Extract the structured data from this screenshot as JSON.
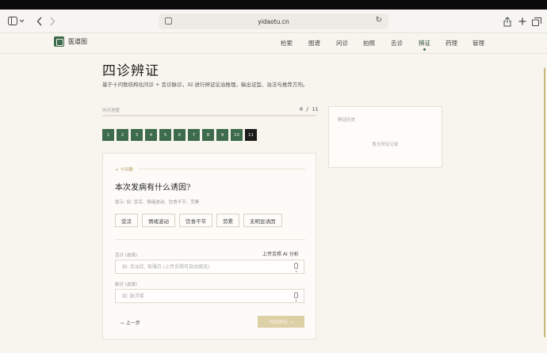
{
  "browser": {
    "url": "yidaotu.cn",
    "icons": {
      "sidebar": "sidebar-icon",
      "back": "chevron-left-icon",
      "forward": "chevron-right-icon",
      "share": "share-icon",
      "new_tab": "plus-icon",
      "tabs": "tabs-icon",
      "reload": "reload-icon"
    }
  },
  "site": {
    "logo_text": "医道图",
    "nav": [
      "检索",
      "图谱",
      "问诊",
      "拍照",
      "舌诊",
      "辨证",
      "药理",
      "管理"
    ],
    "active_nav": "辨证",
    "colors": {
      "brand": "#3d6b4b",
      "accent": "#b39a56"
    }
  },
  "page": {
    "title": "四诊辨证",
    "description": "基于十问歌结构化问诊 + 舌诊脉诊，AI 进行辨证论治推理，输出证型、治法与推荐方剂。"
  },
  "progress": {
    "label": "问诊进度",
    "count_text": "0 / 11",
    "value": 0,
    "steps": [
      "1",
      "2",
      "3",
      "4",
      "5",
      "6",
      "7",
      "8",
      "9",
      "10",
      "11"
    ],
    "current_step": "11"
  },
  "question": {
    "section": "十问歌",
    "text": "本次发病有什么诱因?",
    "hint": "提示: 如: 受凉、情绪波动、饮食不节、劳累",
    "options": [
      "受凉",
      "情绪波动",
      "饮食不节",
      "劳累",
      "无明显诱因"
    ]
  },
  "tongue": {
    "label": "舌诊 (选填)",
    "upload_label": "上传舌照 AI 分析",
    "placeholder": "如: 舌淡红, 苔薄白 (上传舌照可自动填充)",
    "value": ""
  },
  "pulse": {
    "label": "脉诊 (选填)",
    "placeholder": "如: 脉浮紧",
    "value": ""
  },
  "actions": {
    "prev": "← 上一步",
    "next": "开始辨证 →"
  },
  "history": {
    "title": "辨证历史",
    "empty": "暂无辨证记录"
  }
}
